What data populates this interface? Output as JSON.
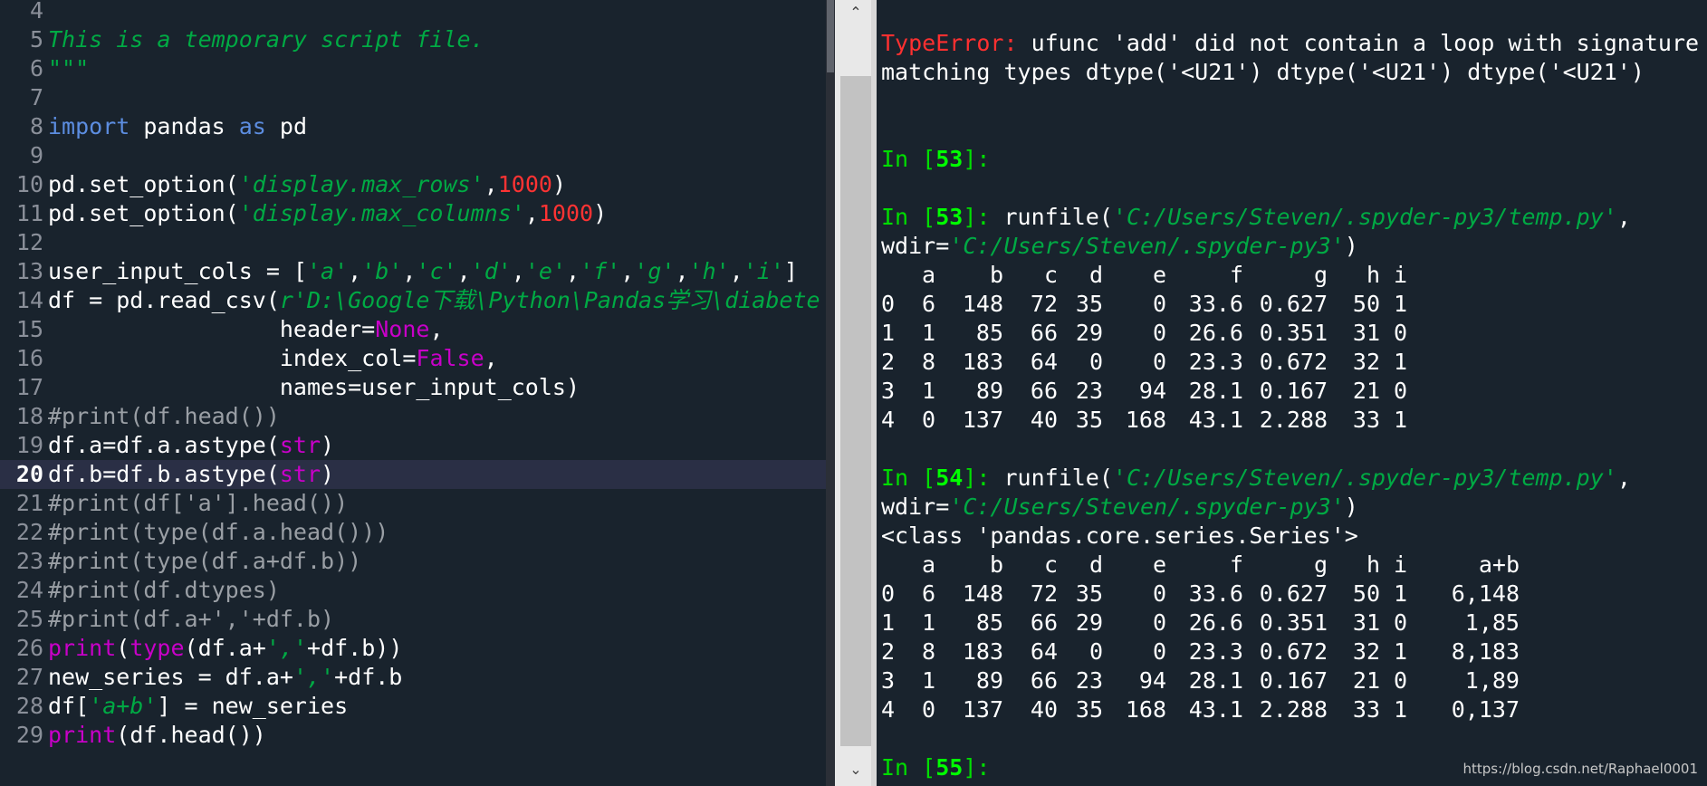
{
  "editor": {
    "current_line": 20,
    "lines": [
      {
        "n": "4",
        "tokens": []
      },
      {
        "n": "5",
        "tokens": [
          {
            "c": "doc",
            "t": "This is a temporary script file."
          }
        ]
      },
      {
        "n": "6",
        "tokens": [
          {
            "c": "doc",
            "t": "\"\"\""
          }
        ]
      },
      {
        "n": "7",
        "tokens": []
      },
      {
        "n": "8",
        "tokens": [
          {
            "c": "kw",
            "t": "import"
          },
          {
            "c": "",
            "t": " pandas "
          },
          {
            "c": "kw",
            "t": "as"
          },
          {
            "c": "",
            "t": " pd"
          }
        ]
      },
      {
        "n": "9",
        "tokens": []
      },
      {
        "n": "10",
        "tokens": [
          {
            "c": "",
            "t": "pd.set_option("
          },
          {
            "c": "str",
            "t": "'display.max_rows'"
          },
          {
            "c": "",
            "t": ","
          },
          {
            "c": "num",
            "t": "1000"
          },
          {
            "c": "",
            "t": ")"
          }
        ]
      },
      {
        "n": "11",
        "tokens": [
          {
            "c": "",
            "t": "pd.set_option("
          },
          {
            "c": "str",
            "t": "'display.max_columns'"
          },
          {
            "c": "",
            "t": ","
          },
          {
            "c": "num",
            "t": "1000"
          },
          {
            "c": "",
            "t": ")"
          }
        ]
      },
      {
        "n": "12",
        "tokens": []
      },
      {
        "n": "13",
        "tokens": [
          {
            "c": "",
            "t": "user_input_cols = ["
          },
          {
            "c": "str",
            "t": "'a'"
          },
          {
            "c": "",
            "t": ","
          },
          {
            "c": "str",
            "t": "'b'"
          },
          {
            "c": "",
            "t": ","
          },
          {
            "c": "str",
            "t": "'c'"
          },
          {
            "c": "",
            "t": ","
          },
          {
            "c": "str",
            "t": "'d'"
          },
          {
            "c": "",
            "t": ","
          },
          {
            "c": "str",
            "t": "'e'"
          },
          {
            "c": "",
            "t": ","
          },
          {
            "c": "str",
            "t": "'f'"
          },
          {
            "c": "",
            "t": ","
          },
          {
            "c": "str",
            "t": "'g'"
          },
          {
            "c": "",
            "t": ","
          },
          {
            "c": "str",
            "t": "'h'"
          },
          {
            "c": "",
            "t": ","
          },
          {
            "c": "str",
            "t": "'i'"
          },
          {
            "c": "",
            "t": "]"
          }
        ]
      },
      {
        "n": "14",
        "tokens": [
          {
            "c": "",
            "t": "df = pd.read_csv("
          },
          {
            "c": "str",
            "t": "r'D:\\Google下载\\Python\\Pandas学习\\diabete"
          }
        ]
      },
      {
        "n": "15",
        "tokens": [
          {
            "c": "",
            "t": "                 header="
          },
          {
            "c": "con",
            "t": "None"
          },
          {
            "c": "",
            "t": ","
          }
        ]
      },
      {
        "n": "16",
        "tokens": [
          {
            "c": "",
            "t": "                 index_col="
          },
          {
            "c": "con",
            "t": "False"
          },
          {
            "c": "",
            "t": ","
          }
        ]
      },
      {
        "n": "17",
        "tokens": [
          {
            "c": "",
            "t": "                 names=user_input_cols)"
          }
        ]
      },
      {
        "n": "18",
        "tokens": [
          {
            "c": "com",
            "t": "#print(df.head())"
          }
        ]
      },
      {
        "n": "19",
        "tokens": [
          {
            "c": "",
            "t": "df.a=df.a.astype("
          },
          {
            "c": "bi",
            "t": "str"
          },
          {
            "c": "",
            "t": ")"
          }
        ]
      },
      {
        "n": "20",
        "tokens": [
          {
            "c": "",
            "t": "df.b=df.b.astype("
          },
          {
            "c": "bi",
            "t": "str"
          },
          {
            "c": "",
            "t": ")"
          }
        ]
      },
      {
        "n": "21",
        "tokens": [
          {
            "c": "com",
            "t": "#print(df['a'].head())"
          }
        ]
      },
      {
        "n": "22",
        "tokens": [
          {
            "c": "com",
            "t": "#print(type(df.a.head()))"
          }
        ]
      },
      {
        "n": "23",
        "tokens": [
          {
            "c": "com",
            "t": "#print(type(df.a+df.b))"
          }
        ]
      },
      {
        "n": "24",
        "tokens": [
          {
            "c": "com",
            "t": "#print(df.dtypes)"
          }
        ]
      },
      {
        "n": "25",
        "tokens": [
          {
            "c": "com",
            "t": "#print(df.a+','+df.b)"
          }
        ]
      },
      {
        "n": "26",
        "tokens": [
          {
            "c": "bi",
            "t": "print"
          },
          {
            "c": "",
            "t": "("
          },
          {
            "c": "bi",
            "t": "type"
          },
          {
            "c": "",
            "t": "(df.a+"
          },
          {
            "c": "str",
            "t": "','"
          },
          {
            "c": "",
            "t": "+df.b))"
          }
        ]
      },
      {
        "n": "27",
        "tokens": [
          {
            "c": "",
            "t": "new_series = df.a+"
          },
          {
            "c": "str",
            "t": "','"
          },
          {
            "c": "",
            "t": "+df.b"
          }
        ]
      },
      {
        "n": "28",
        "tokens": [
          {
            "c": "",
            "t": "df["
          },
          {
            "c": "str",
            "t": "'a+b'"
          },
          {
            "c": "",
            "t": "] = new_series"
          }
        ]
      },
      {
        "n": "29",
        "tokens": [
          {
            "c": "bi",
            "t": "print"
          },
          {
            "c": "",
            "t": "(df.head())"
          }
        ]
      }
    ]
  },
  "scrollbar": {
    "up_arrow": "⌃",
    "down_arrow": "⌄"
  },
  "console": {
    "error_type": "TypeError:",
    "error_msg_1": " ufunc 'add' did not contain a loop with signature",
    "error_msg_2": "matching types dtype('<U21') dtype('<U21') dtype('<U21')",
    "prompts": [
      {
        "label": "In [",
        "num": "53",
        "end": "]:"
      },
      {
        "label": "In [",
        "num": "53",
        "end": "]:"
      },
      {
        "label": "In [",
        "num": "54",
        "end": "]:"
      },
      {
        "label": "In [",
        "num": "55",
        "end": "]:"
      }
    ],
    "runfile_prefix": " runfile(",
    "runfile_path": "'C:/Users/Steven/.spyder-py3/temp.py'",
    "runfile_comma": ",",
    "wdir_prefix": "wdir=",
    "wdir_path": "'C:/Users/Steven/.spyder-py3'",
    "wdir_suffix": ")",
    "class_line": "<class 'pandas.core.series.Series'>",
    "table1": {
      "columns": [
        "",
        "a",
        "b",
        "c",
        "d",
        "e",
        "f",
        "g",
        "h",
        "i"
      ],
      "rows": [
        [
          "0",
          "6",
          "148",
          "72",
          "35",
          "0",
          "33.6",
          "0.627",
          "50",
          "1"
        ],
        [
          "1",
          "1",
          "85",
          "66",
          "29",
          "0",
          "26.6",
          "0.351",
          "31",
          "0"
        ],
        [
          "2",
          "8",
          "183",
          "64",
          "0",
          "0",
          "23.3",
          "0.672",
          "32",
          "1"
        ],
        [
          "3",
          "1",
          "89",
          "66",
          "23",
          "94",
          "28.1",
          "0.167",
          "21",
          "0"
        ],
        [
          "4",
          "0",
          "137",
          "40",
          "35",
          "168",
          "43.1",
          "2.288",
          "33",
          "1"
        ]
      ]
    },
    "table2": {
      "columns": [
        "",
        "a",
        "b",
        "c",
        "d",
        "e",
        "f",
        "g",
        "h",
        "i",
        "a+b"
      ],
      "rows": [
        [
          "0",
          "6",
          "148",
          "72",
          "35",
          "0",
          "33.6",
          "0.627",
          "50",
          "1",
          "6,148"
        ],
        [
          "1",
          "1",
          "85",
          "66",
          "29",
          "0",
          "26.6",
          "0.351",
          "31",
          "0",
          "1,85"
        ],
        [
          "2",
          "8",
          "183",
          "64",
          "0",
          "0",
          "23.3",
          "0.672",
          "32",
          "1",
          "8,183"
        ],
        [
          "3",
          "1",
          "89",
          "66",
          "23",
          "94",
          "28.1",
          "0.167",
          "21",
          "0",
          "1,89"
        ],
        [
          "4",
          "0",
          "137",
          "40",
          "35",
          "168",
          "43.1",
          "2.288",
          "33",
          "1",
          "0,137"
        ]
      ]
    }
  },
  "watermark": "https://blog.csdn.net/Raphael0001"
}
